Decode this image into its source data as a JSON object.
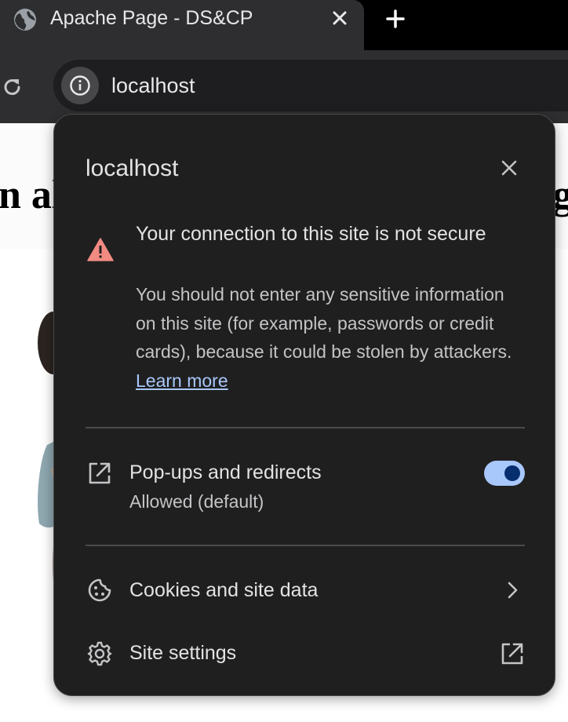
{
  "browser": {
    "tab_title": "Apache Page - DS&CP",
    "url": "localhost",
    "icons": {
      "favicon": "globe-icon",
      "tab_close": "close-icon",
      "new_tab": "plus-icon",
      "reload": "reload-icon",
      "site_info": "info-icon"
    }
  },
  "page": {
    "heading_left": "n al",
    "heading_right": "g"
  },
  "popup": {
    "title": "localhost",
    "warning": {
      "title": "Your connection to this site is not secure",
      "body": "You should not enter any sensitive information on this site (for example, passwords or credit cards), because it could be stolen by attackers.",
      "link": "Learn more",
      "icon": "warning-triangle-icon",
      "icon_color": "#f28b82"
    },
    "popups": {
      "label": "Pop-ups and redirects",
      "status": "Allowed (default)",
      "enabled": true,
      "icon": "open-in-new-icon"
    },
    "cookies": {
      "label": "Cookies and site data",
      "icon": "cookie-icon",
      "trailing_icon": "chevron-right-icon"
    },
    "settings": {
      "label": "Site settings",
      "icon": "gear-icon",
      "trailing_icon": "open-in-new-icon"
    }
  },
  "colors": {
    "popup_bg": "#1f1f1f",
    "accent": "#a8c7fa",
    "toggle_knob": "#062e6f"
  }
}
